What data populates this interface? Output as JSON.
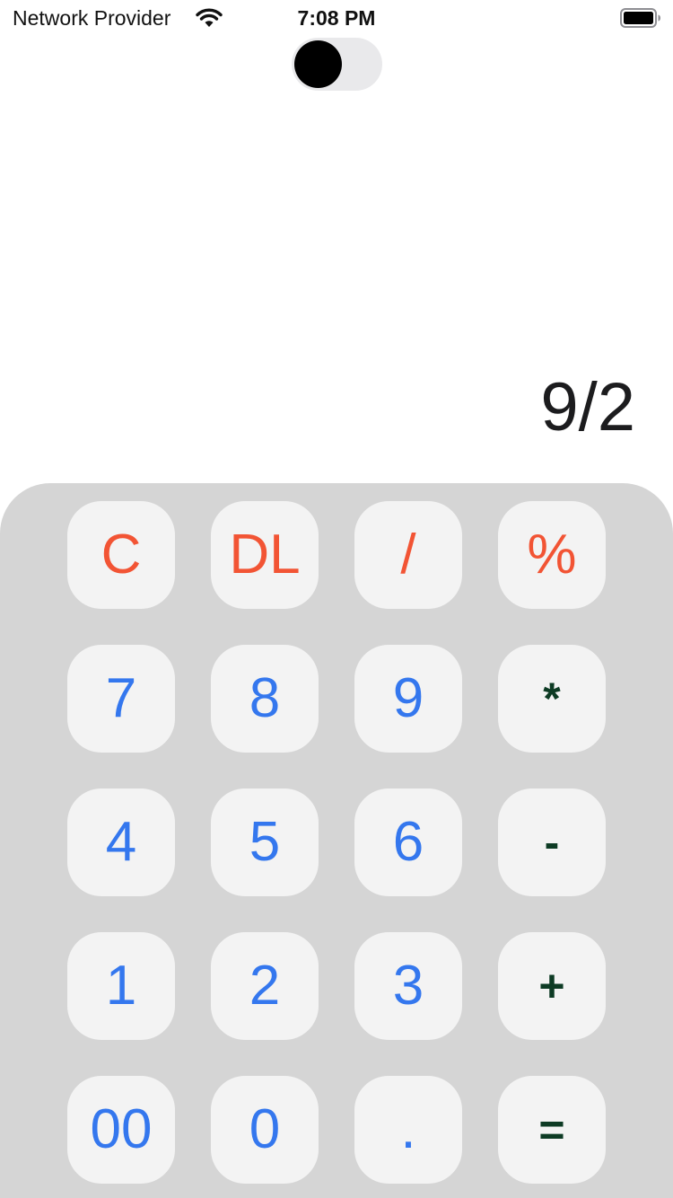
{
  "status_bar": {
    "carrier": "Network Provider",
    "time": "7:08 PM",
    "wifi_icon": "wifi-icon",
    "battery_icon": "battery-icon"
  },
  "theme_toggle": {
    "state": "off"
  },
  "display": {
    "expression": "9/2"
  },
  "colors": {
    "function_key": "#f25434",
    "digit_key": "#3477ee",
    "operator_key": "#0d3b24",
    "keypad_background": "#d5d5d5",
    "key_background": "#f3f3f3"
  },
  "keypad": {
    "row1": [
      "C",
      "DL",
      "/",
      "%"
    ],
    "row2": [
      "7",
      "8",
      "9",
      "*"
    ],
    "row3": [
      "4",
      "5",
      "6",
      "-"
    ],
    "row4": [
      "1",
      "2",
      "3",
      "+"
    ],
    "row5": [
      "00",
      "0",
      ".",
      "="
    ]
  }
}
